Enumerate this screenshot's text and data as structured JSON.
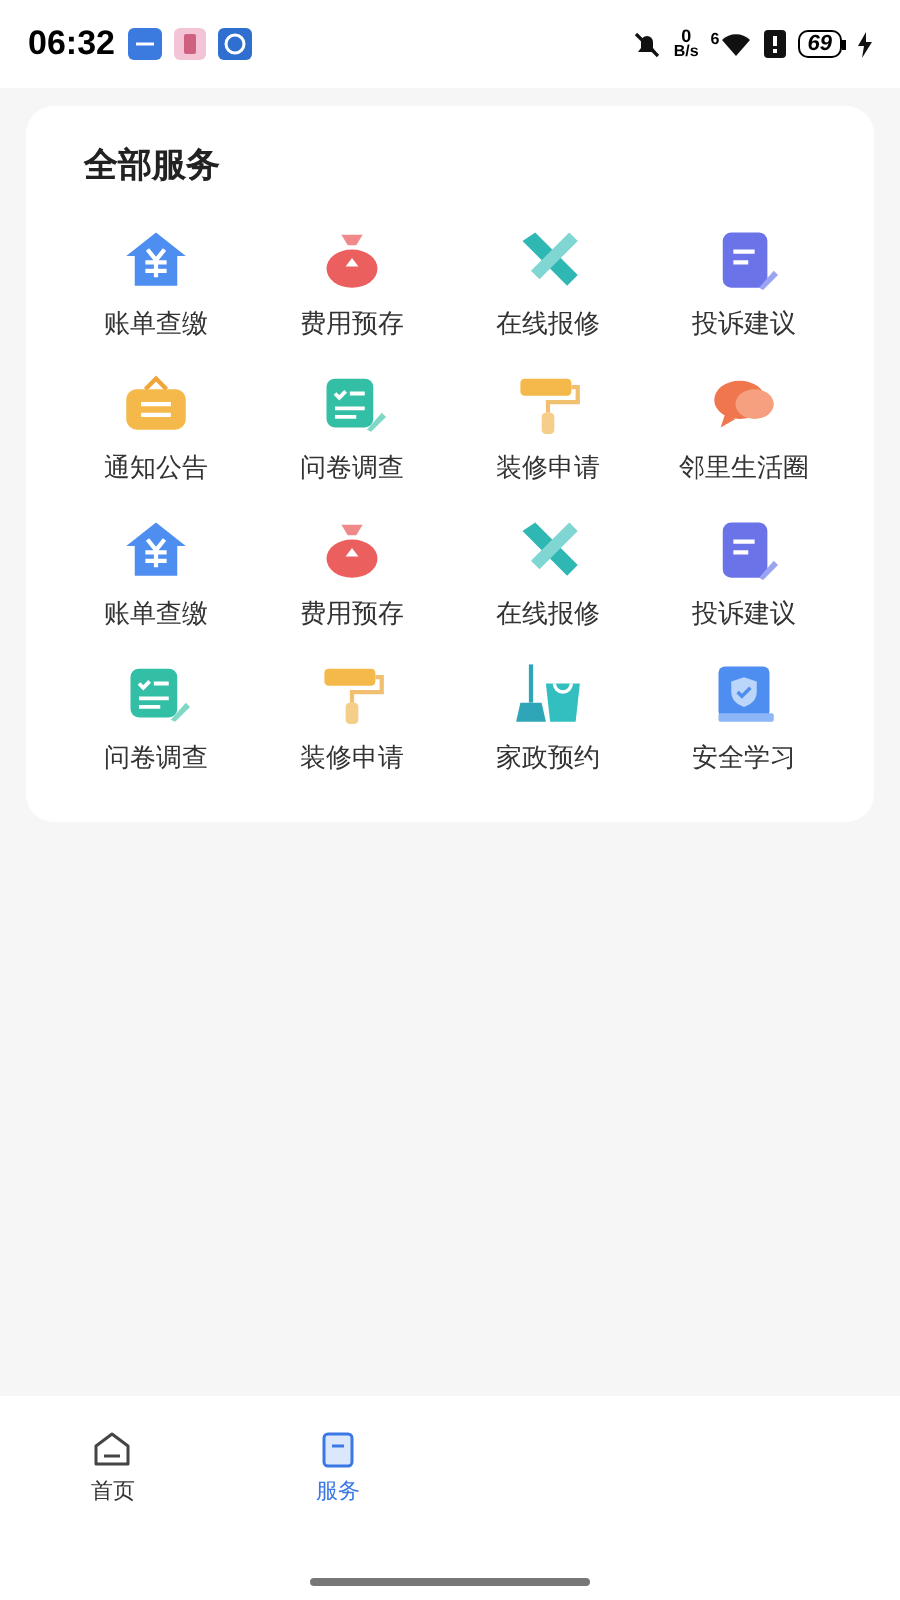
{
  "status_bar": {
    "time": "06:32",
    "net_speed_value": "0",
    "net_speed_unit": "B/s",
    "wifi_label": "6",
    "battery": "69"
  },
  "services": {
    "title": "全部服务",
    "items": [
      {
        "label": "账单查缴",
        "kind": "bill"
      },
      {
        "label": "费用预存",
        "kind": "moneybag"
      },
      {
        "label": "在线报修",
        "kind": "tools"
      },
      {
        "label": "投诉建议",
        "kind": "complaint"
      },
      {
        "label": "通知公告",
        "kind": "notice"
      },
      {
        "label": "问卷调查",
        "kind": "survey"
      },
      {
        "label": "装修申请",
        "kind": "roller"
      },
      {
        "label": "邻里生活圈",
        "kind": "chat"
      },
      {
        "label": "账单查缴",
        "kind": "bill"
      },
      {
        "label": "费用预存",
        "kind": "moneybag"
      },
      {
        "label": "在线报修",
        "kind": "tools"
      },
      {
        "label": "投诉建议",
        "kind": "complaint"
      },
      {
        "label": "问卷调查",
        "kind": "survey"
      },
      {
        "label": "装修申请",
        "kind": "roller"
      },
      {
        "label": "家政预约",
        "kind": "housekeeping"
      },
      {
        "label": "安全学习",
        "kind": "safety"
      }
    ]
  },
  "tab_bar": [
    {
      "label": "首页",
      "kind": "home",
      "selected": false
    },
    {
      "label": "服务",
      "kind": "service",
      "selected": true
    }
  ]
}
